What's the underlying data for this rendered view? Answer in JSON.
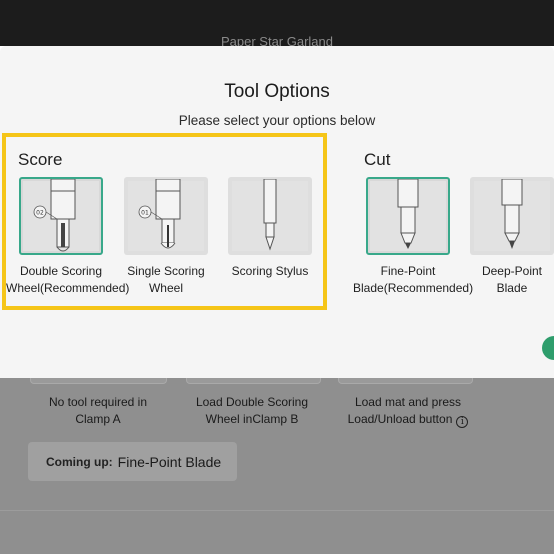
{
  "app": {
    "title": "Paper Star Garland"
  },
  "modal": {
    "title": "Tool Options",
    "subtitle": "Please select your options below",
    "score": {
      "heading": "Score",
      "tools": [
        {
          "line1": "Double Scoring",
          "line2": "Wheel(Recommended)",
          "badge": "02",
          "selected": true
        },
        {
          "line1": "Single Scoring",
          "line2": "Wheel",
          "badge": "01",
          "selected": false
        },
        {
          "line1": "Scoring Stylus",
          "line2": "",
          "badge": "",
          "selected": false
        }
      ]
    },
    "cut": {
      "heading": "Cut",
      "tools": [
        {
          "line1": "Fine-Point",
          "line2": "Blade(Recommended)",
          "selected": true
        },
        {
          "line1": "Deep-Point",
          "line2": "Blade",
          "selected": false
        }
      ]
    },
    "highlight_color": "#f5c518",
    "selected_color": "#38a88a"
  },
  "background": {
    "steps": [
      {
        "line1": "No tool required in",
        "line2": "Clamp A"
      },
      {
        "line1": "Load Double Scoring",
        "line2": "Wheel inClamp B"
      },
      {
        "line1": "Load mat and press",
        "line2": "Load/Unload button",
        "icon": "info-icon"
      }
    ],
    "coming_up": {
      "label": "Coming up:",
      "value": "Fine-Point Blade"
    }
  }
}
